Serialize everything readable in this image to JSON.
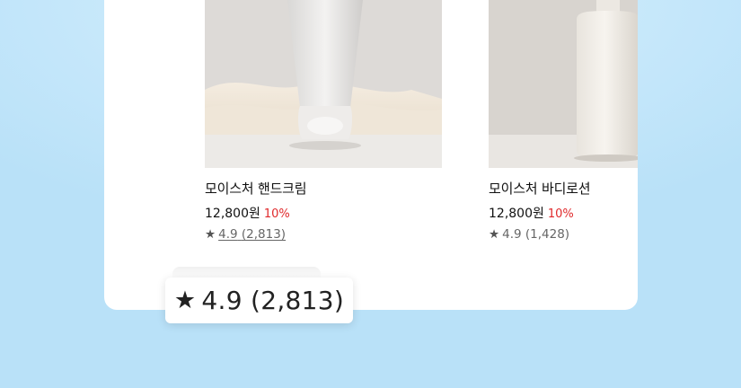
{
  "products": [
    {
      "name": "모이스처 핸드크림",
      "price": "12,800원",
      "discount": "10%",
      "rating": "4.9",
      "reviews": "(2,813)"
    },
    {
      "name": "모이스처 바디로션",
      "price": "12,800원",
      "discount": "10%",
      "rating": "4.9",
      "reviews": "(1,428)"
    }
  ],
  "tooltip": {
    "rating": "4.9",
    "reviews": "(2,813)"
  },
  "icons": {
    "star": "star-icon"
  },
  "colors": {
    "discount": "#e0292b",
    "background": "#bfe4f9",
    "card": "#ffffff"
  }
}
